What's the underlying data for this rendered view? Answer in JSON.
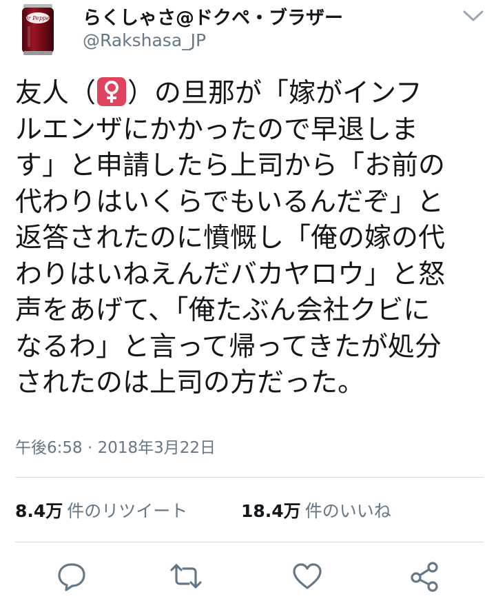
{
  "user": {
    "display_name": "らくしゃさ@ドクペ・ブラザー",
    "handle": "@Rakshasa_JP",
    "avatar_can_brand": "Dr Pepper"
  },
  "tweet": {
    "lines": [
      [
        "友人（",
        "）の旦那が「嫁がインフ"
      ],
      "ルエンザにかかったので早退しま",
      "す」と申請したら上司から「お前の",
      "代わりはいくらでもいるんだぞ」と",
      "返答されたのに憤慨し「俺の嫁の代",
      "わりはいねえんだバカヤロウ」と怒",
      "声をあげて、「俺たぶん会社クビに",
      "なるわ」と言って帰ってきたが処分",
      "されたのは上司の方だった。"
    ],
    "emoji": "female-sign-icon",
    "timestamp": "午後6:58 · 2018年3月22日"
  },
  "stats": {
    "retweets": {
      "count": "8.4万",
      "label": "件のリツイート"
    },
    "likes": {
      "count": "18.4万",
      "label": "件のいいね"
    }
  },
  "actions": [
    "reply-icon",
    "retweet-icon",
    "like-icon",
    "share-icon"
  ],
  "colors": {
    "text": "#14171a",
    "secondary": "#657786",
    "divider": "#d8dde1",
    "emoji_bg": "#e0435e",
    "can_red": "#7a0c18"
  }
}
